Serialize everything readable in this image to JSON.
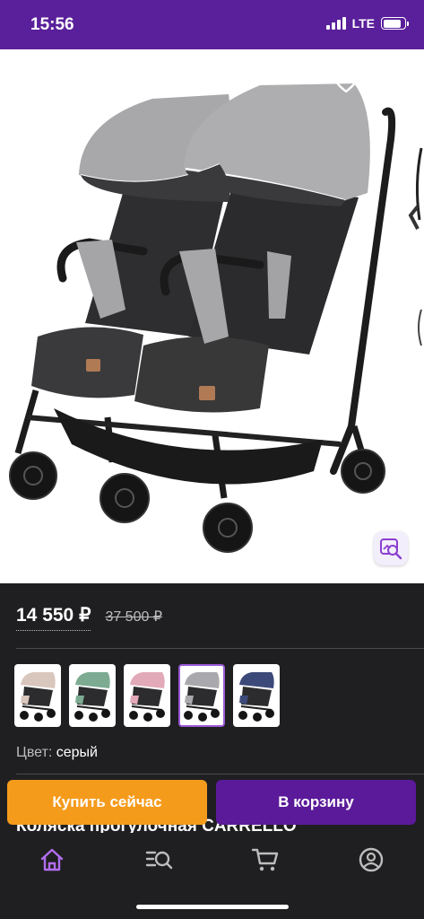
{
  "status_bar": {
    "time": "15:56",
    "network": "LTE",
    "battery_level": 0.85
  },
  "gallery": {
    "back_icon": "chevron-left-icon",
    "favorite_icon": "heart-outline-icon",
    "share_icon": "share-icon",
    "visual_search_icon": "image-search-icon",
    "product_image": "twin-stroller-grey"
  },
  "price": {
    "current": "14 550 ₽",
    "old": "37 500 ₽"
  },
  "colors": {
    "options": [
      {
        "name": "beige",
        "hood": "#d9c6bd"
      },
      {
        "name": "green",
        "hood": "#7cab92"
      },
      {
        "name": "pink",
        "hood": "#e2a9b8"
      },
      {
        "name": "grey",
        "hood": "#a9a9ad"
      },
      {
        "name": "navy",
        "hood": "#3c4a7a"
      }
    ],
    "selected_index": 3,
    "label": "Цвет:",
    "value": "серый"
  },
  "product_title": "Коляска прогулочная CARRELLO",
  "actions": {
    "buy_now": "Купить сейчас",
    "add_to_cart": "В корзину"
  },
  "tabs": [
    {
      "icon": "home-icon",
      "active": true
    },
    {
      "icon": "catalog-search-icon",
      "active": false
    },
    {
      "icon": "cart-icon",
      "active": false
    },
    {
      "icon": "profile-icon",
      "active": false
    }
  ],
  "theme": {
    "brand": "#5b1a9a",
    "accent": "#f59b1c",
    "active_tab": "#b36ef0",
    "background": "#1f1f21"
  }
}
